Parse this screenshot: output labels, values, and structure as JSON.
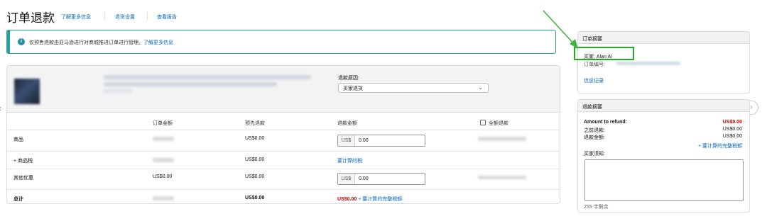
{
  "header": {
    "title": "订单退款",
    "links": [
      "了解更多信息",
      "退货设置",
      "查看报告"
    ]
  },
  "banner": {
    "text": "仅预售退款由亚马逊进行对商城推进订单进行管理。",
    "link": "了解更多信息"
  },
  "reason": {
    "label": "退款原因:",
    "selected": "买家退货"
  },
  "table": {
    "headers": [
      "订单金额",
      "预先退款",
      "退款金额",
      "全额退款"
    ],
    "rows": [
      {
        "label": "商品",
        "prior": "US$0.00",
        "currency": "US$",
        "input": "0.00"
      },
      {
        "label": "+ 商品税",
        "prior": "US$0.00",
        "link": "要计算的税"
      },
      {
        "label": "其他优惠",
        "amount": "US$0.00",
        "prior": "US$0.00",
        "currency": "US$",
        "input": "0.00"
      },
      {
        "label": "总计",
        "prior": "US$0.00",
        "total": "US$0.00",
        "plus": "+",
        "link": "要计算的完整税额"
      }
    ]
  },
  "order_summary": {
    "title": "订单摘要",
    "buyer": "买家: Alan Al",
    "order_no": "订单编号:",
    "link": "信息记录"
  },
  "refund_summary": {
    "title": "退款摘要",
    "amount_label": "Amount to refund:",
    "amount_value": "US$0.00",
    "prior_label": "之前退款:",
    "prior_value": "US$0.00",
    "refund_label": "退款金额:",
    "refund_value": "US$0.00",
    "tax_link": "+ 要计算的完整税额",
    "note_label": "买家须知:",
    "char_count": "255 字剩余"
  },
  "colors": {
    "accent": "#2a9fa0",
    "link": "#0066c0",
    "highlight": "#22aa22",
    "alert": "#c40000"
  },
  "icons": [
    "info-icon",
    "chevron-down-icon",
    "chevron-left-icon",
    "chevron-right-icon",
    "annotation-arrow-icon"
  ]
}
